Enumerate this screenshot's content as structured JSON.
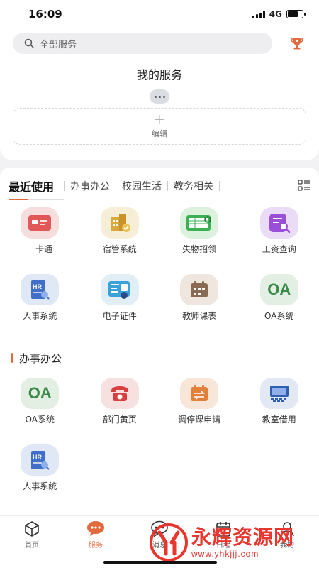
{
  "status": {
    "time": "16:09",
    "network": "4G",
    "battery_level": 0.7
  },
  "search": {
    "placeholder": "全部服务"
  },
  "my_services": {
    "title": "我的服务",
    "edit_label": "编辑"
  },
  "tabs": [
    "最近使用",
    "办事办公",
    "校园生活",
    "教务相关"
  ],
  "recent": [
    {
      "label": "一卡通",
      "icon": "card-icon",
      "bg": "#f6dede"
    },
    {
      "label": "宿管系统",
      "icon": "dormitory-icon",
      "bg": "#f7eed8"
    },
    {
      "label": "失物招领",
      "icon": "lost-found-icon",
      "bg": "#dcf1de"
    },
    {
      "label": "工资查询",
      "icon": "salary-query-icon",
      "bg": "#eadcf6"
    },
    {
      "label": "人事系统",
      "icon": "hr-icon",
      "bg": "#e0e8f6"
    },
    {
      "label": "电子证件",
      "icon": "id-card-icon",
      "bg": "#e2eef6"
    },
    {
      "label": "教师课表",
      "icon": "timetable-icon",
      "bg": "#efe7df"
    },
    {
      "label": "OA系统",
      "icon": "oa-icon",
      "bg": "#e4efe4"
    }
  ],
  "office_section": {
    "title": "办事办公",
    "items": [
      {
        "label": "OA系统",
        "icon": "oa-icon",
        "bg": "#e4efe4"
      },
      {
        "label": "部门黄页",
        "icon": "telephone-icon",
        "bg": "#f6e0e0"
      },
      {
        "label": "调停课申请",
        "icon": "class-adjust-icon",
        "bg": "#f8e6d8"
      },
      {
        "label": "教室借用",
        "icon": "classroom-icon",
        "bg": "#e2e8f4"
      },
      {
        "label": "人事系统",
        "icon": "hr-icon",
        "bg": "#e0e8f6"
      }
    ]
  },
  "nav": [
    {
      "label": "首页",
      "icon": "home-icon"
    },
    {
      "label": "服务",
      "icon": "service-icon"
    },
    {
      "label": "消息",
      "icon": "message-icon"
    },
    {
      "label": "日程",
      "icon": "calendar-icon"
    },
    {
      "label": "我的",
      "icon": "profile-icon"
    }
  ],
  "watermark": {
    "title": "永辉资源网",
    "url": "www.yhkjjj.com"
  },
  "colors": {
    "accent": "#e36a3c",
    "watermark": "#e8352e"
  }
}
